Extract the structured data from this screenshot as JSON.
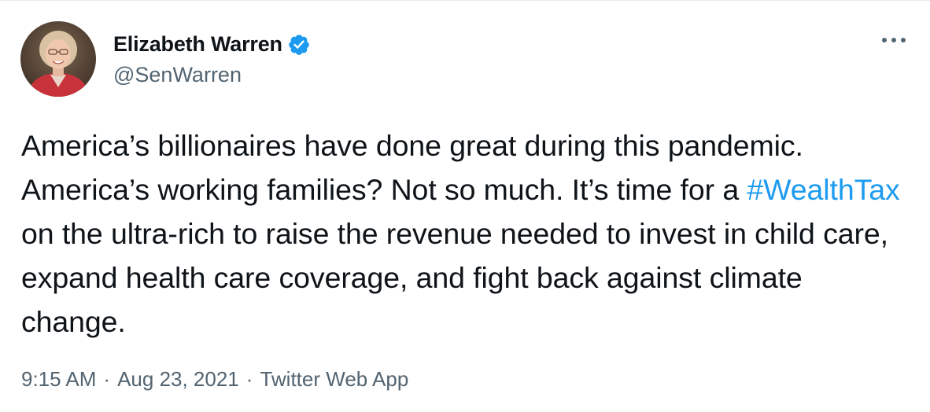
{
  "tweet": {
    "author": {
      "display_name": "Elizabeth Warren",
      "handle": "@SenWarren",
      "verified": true
    },
    "text_before": "America’s billionaires have done great during this pandemic. America’s working families? Not so much. It’s time for a ",
    "hashtag": "#WealthTax",
    "text_after": " on the ultra-rich to raise the revenue needed to invest in child care, expand health care coverage, and fight back against climate change.",
    "meta": {
      "time": "9:15 AM",
      "separator": "·",
      "date": "Aug 23, 2021",
      "source": "Twitter Web App"
    }
  },
  "icons": {
    "verified": "verified-badge-icon",
    "more": "more-horizontal-icon"
  },
  "colors": {
    "accent": "#1d9bf0",
    "text_primary": "#0f1419",
    "text_secondary": "#536471"
  }
}
